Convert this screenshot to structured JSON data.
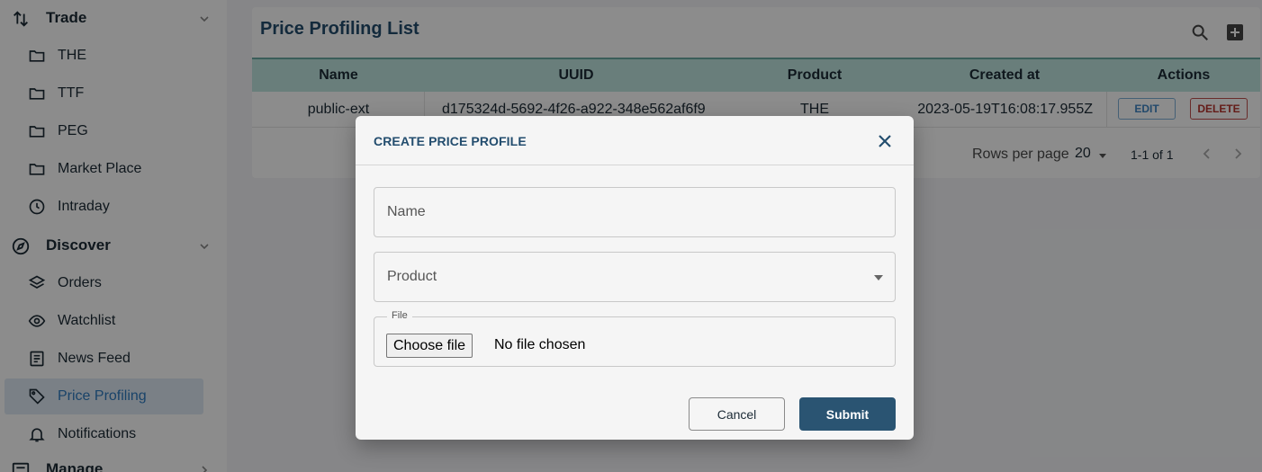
{
  "sidebar": {
    "sections": [
      {
        "label": "Trade",
        "icon": "swap-vertical-icon"
      },
      {
        "label": "Discover",
        "icon": "compass-icon"
      },
      {
        "label": "Manage",
        "icon": "dashboard-icon"
      }
    ],
    "trade_items": [
      {
        "label": "THE",
        "icon": "folder-icon"
      },
      {
        "label": "TTF",
        "icon": "folder-icon"
      },
      {
        "label": "PEG",
        "icon": "folder-icon"
      },
      {
        "label": "Market Place",
        "icon": "folder-icon"
      },
      {
        "label": "Intraday",
        "icon": "clock-icon"
      }
    ],
    "discover_items": [
      {
        "label": "Orders",
        "icon": "layers-icon"
      },
      {
        "label": "Watchlist",
        "icon": "eye-icon"
      },
      {
        "label": "News Feed",
        "icon": "article-icon"
      },
      {
        "label": "Price Profiling",
        "icon": "tag-icon",
        "active": true
      },
      {
        "label": "Notifications",
        "icon": "bell-icon"
      }
    ]
  },
  "main": {
    "title": "Price Profiling List",
    "table": {
      "columns": [
        "Name",
        "UUID",
        "Product",
        "Created at",
        "Actions"
      ],
      "rows": [
        {
          "name": "public-ext",
          "uuid": "d175324d-5692-4f26-a922-348e562af6f9",
          "product": "THE",
          "created_at": "2023-05-19T16:08:17.955Z",
          "edit_label": "EDIT",
          "delete_label": "DELETE"
        }
      ]
    },
    "pagination": {
      "rows_per_page_label": "Rows per page",
      "rows_per_page": "20",
      "range": "1-1 of 1"
    }
  },
  "modal": {
    "title": "CREATE PRICE PROFILE",
    "name_placeholder": "Name",
    "product_placeholder": "Product",
    "file_label": "File",
    "choose_file_label": "Choose file",
    "file_status": "No file chosen",
    "cancel_label": "Cancel",
    "submit_label": "Submit"
  },
  "colors": {
    "accent": "#234d6e",
    "header_teal": "#bfe6e0",
    "active_bg": "#dfe9f4",
    "active_text": "#2e7bc0",
    "submit_bg": "#2a5472",
    "delete_red": "#b7332f"
  }
}
